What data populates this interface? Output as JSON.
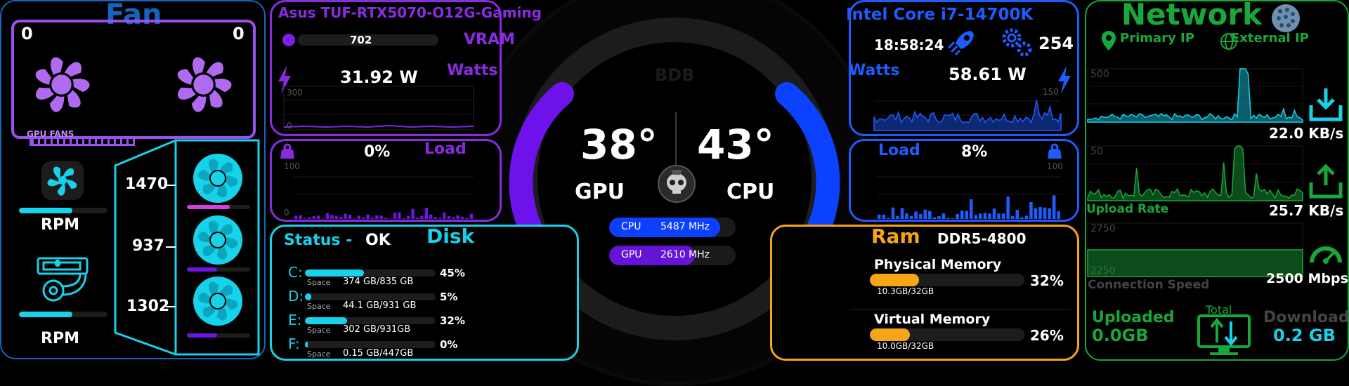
{
  "colors": {
    "purple": "#8a2be2",
    "blue": "#1e5cff",
    "cyan": "#16d2ea",
    "orange": "#f5a515",
    "green": "#18a83a",
    "fan_blue": "#1565c0"
  },
  "fan": {
    "title": "Fan",
    "gpu_fan_left": "0",
    "gpu_fan_right": "0",
    "gpu_fans_label": "GPU FANS",
    "rpm_label_1": "RPM",
    "rpm_label_2": "RPM",
    "rpm_level_1": 0.6,
    "rpm_level_2": 0.6,
    "case_fans": [
      {
        "value": "1470",
        "level": 0.68
      },
      {
        "value": "937",
        "level": 0.48
      },
      {
        "value": "1302",
        "level": 0.48
      }
    ]
  },
  "gpu": {
    "name": "Asus TUF-RTX5070-O12G-Gaming",
    "vram_value": "702",
    "vram_label": "VRAM",
    "watts_label": "Watts",
    "watts_value": "31.92 W",
    "watts_axis_max": "300",
    "watts_axis_min": "0",
    "load_label": "Load",
    "load_value": "0%",
    "load_axis_max": "100",
    "load_axis_min": "0"
  },
  "center": {
    "brand": "BDB",
    "gpu_temp": "38°",
    "gpu_label": "GPU",
    "cpu_temp": "43°",
    "cpu_label": "CPU",
    "cpu_clock_label": "CPU",
    "cpu_clock_value": "5487",
    "cpu_clock_unit": "MHz",
    "cpu_clock_level": 0.88,
    "gpu_clock_label": "GPU",
    "gpu_clock_value": "2610",
    "gpu_clock_unit": "MHz",
    "gpu_clock_level": 0.68
  },
  "cpu": {
    "name": "Intel Core i7-14700K",
    "time": "18:58:24",
    "process_count": "254",
    "watts_label": "Watts",
    "watts_value": "58.61 W",
    "watts_axis_max": "150",
    "load_label": "Load",
    "load_value": "8%",
    "load_axis_max": "100"
  },
  "disk": {
    "status_label": "Status -",
    "status_value": "OK",
    "title": "Disk",
    "space_label": "Space",
    "drives": [
      {
        "letter": "C:",
        "space": "374 GB/835 GB",
        "percent": "45%",
        "level": 0.45
      },
      {
        "letter": "D:",
        "space": "44.1 GB/931 GB",
        "percent": "5%",
        "level": 0.05
      },
      {
        "letter": "E:",
        "space": "302 GB/931GB",
        "percent": "32%",
        "level": 0.32
      },
      {
        "letter": "F:",
        "space": "0.15 GB/447GB",
        "percent": "0%",
        "level": 0.0
      }
    ]
  },
  "ram": {
    "title": "Ram",
    "type": "DDR5-4800",
    "physical_label": "Physical Memory",
    "physical_detail": "10.3GB/32GB",
    "physical_percent": "32%",
    "physical_level": 0.32,
    "virtual_label": "Virtual Memory",
    "virtual_detail": "10.0GB/32GB",
    "virtual_percent": "26%",
    "virtual_level": 0.26
  },
  "network": {
    "title": "Network",
    "primary_ip_label": "Primary IP",
    "external_ip_label": "External IP",
    "download_axis_max": "500",
    "download_axis_min": "0",
    "download_rate": "22.0 KB/s",
    "upload_axis_max": "50",
    "upload_axis_min": "0",
    "upload_label": "Upload Rate",
    "upload_rate": "25.7 KB/s",
    "speed_axis_max": "2750",
    "speed_axis_min": "2250",
    "speed_label": "Connection Speed",
    "speed_value": "2500 Mbps",
    "uploaded_label": "Uploaded",
    "uploaded_value": "0.0GB",
    "total_label": "Total",
    "download_label": "Download",
    "download_value": "0.2 GB"
  }
}
